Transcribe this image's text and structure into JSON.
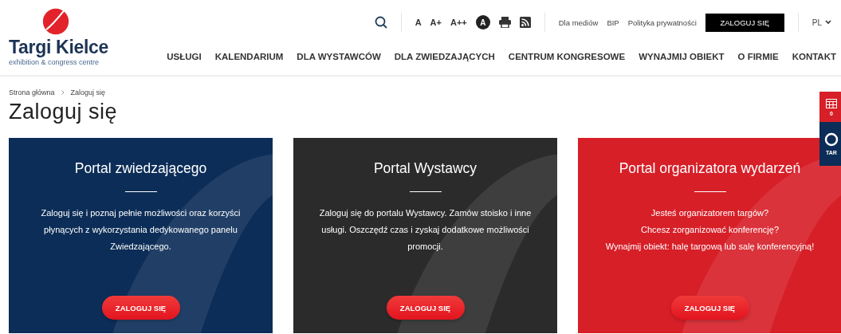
{
  "logo": {
    "name": "Targi Kielce",
    "tagline": "exhibition & congress centre"
  },
  "font_size_buttons": [
    "A",
    "A+",
    "A++"
  ],
  "contrast_button": "A",
  "top_links": [
    "Dla mediów",
    "BIP",
    "Polityka prywatności"
  ],
  "login_button": "ZALOGUJ SIĘ",
  "language": "PL",
  "nav": [
    "USŁUGI",
    "KALENDARIUM",
    "DLA WYSTAWCÓW",
    "DLA ZWIEDZAJĄCYCH",
    "CENTRUM KONGRESOWE",
    "WYNAJMIJ OBIEKT",
    "O FIRMIE",
    "KONTAKT"
  ],
  "breadcrumb": [
    "Strona główna",
    "Zaloguj się"
  ],
  "page_title": "Zaloguj się",
  "cards": [
    {
      "title": "Portal zwiedzającego",
      "color": "#0c2d57",
      "paragraphs": [
        "Zaloguj się i poznaj pełnie możliwości oraz korzyści płynących z wykorzystania dedykowanego panelu Zwiedzającego."
      ],
      "button": "ZALOGUJ SIĘ"
    },
    {
      "title": "Portal Wystawcy",
      "color": "#2b2b2b",
      "paragraphs": [
        "Zaloguj się do portalu Wystawcy. Zamów stoisko i inne usługi. Oszczędź czas i zyskaj dodatkowe możliwości promocji."
      ],
      "button": "ZALOGUJ SIĘ"
    },
    {
      "title": "Portal organizatora wydarzeń",
      "color": "#d71f28",
      "paragraphs": [
        "Jesteś organizatorem targów?",
        "Chcesz zorganizować konferencję?",
        "Wynajmij obiekt: halę targową lub salę konferencyjną!"
      ],
      "button": "ZALOGUJ SIĘ"
    }
  ],
  "side_widget": {
    "top_text": "0",
    "bottom_text": "TAR"
  }
}
